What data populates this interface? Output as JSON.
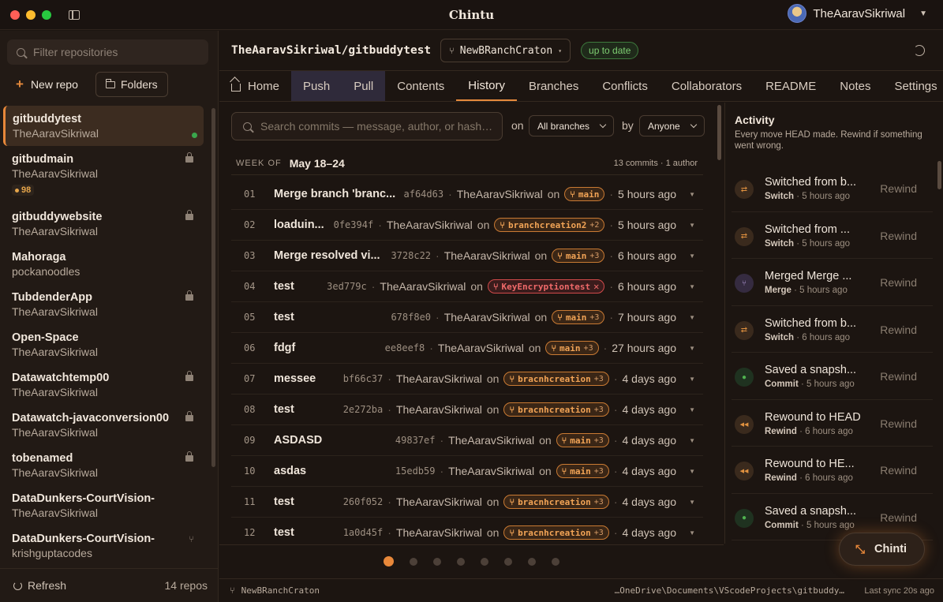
{
  "app": {
    "title": "Chintu",
    "user": "TheAaravSikriwal"
  },
  "colors": {
    "accent": "#e8883a",
    "ok": "#7fcf73",
    "danger": "#f06a6a"
  },
  "sidebar": {
    "filter_placeholder": "Filter repositories",
    "new_repo": "New repo",
    "folders": "Folders",
    "refresh": "Refresh",
    "count": "14 repos",
    "repos": [
      {
        "name": "gitbuddytest",
        "owner": "TheAaravSikriwal",
        "active": true
      },
      {
        "name": "gitbudmain",
        "owner": "TheAaravSikriwal",
        "private": true,
        "badge": "98"
      },
      {
        "name": "gitbuddywebsite",
        "owner": "TheAaravSikriwal",
        "private": true
      },
      {
        "name": "Mahoraga",
        "owner": "pockanoodles"
      },
      {
        "name": "TubdenderApp",
        "owner": "TheAaravSikriwal",
        "private": true
      },
      {
        "name": "Open-Space",
        "owner": "TheAaravSikriwal"
      },
      {
        "name": "Datawatchtemp00",
        "owner": "TheAaravSikriwal",
        "private": true
      },
      {
        "name": "Datawatch-javaconversion00",
        "owner": "TheAaravSikriwal",
        "private": true
      },
      {
        "name": "tobenamed",
        "owner": "TheAaravSikriwal",
        "private": true
      },
      {
        "name": "DataDunkers-CourtVision-",
        "owner": "TheAaravSikriwal"
      },
      {
        "name": "DataDunkers-CourtVision-",
        "owner": "krishguptacodes",
        "fork": true
      }
    ]
  },
  "header": {
    "repo_path": "TheAaravSikriwal/gitbuddytest",
    "branch": "NewBRanchCraton",
    "status": "up to date"
  },
  "tabs": [
    "Home",
    "Push",
    "Pull",
    "Contents",
    "History",
    "Branches",
    "Conflicts",
    "Collaborators",
    "README",
    "Notes",
    "Settings"
  ],
  "history": {
    "search_placeholder": "Search commits — message, author, or hash…",
    "on_label": "on",
    "branch_filter": "All branches",
    "by_label": "by",
    "author_filter": "Anyone",
    "week_label": "WEEK OF",
    "week_range": "May 18–24",
    "week_stats": "13 commits · 1 author",
    "commits": [
      {
        "n": "01",
        "msg": "Merge branch 'branc...",
        "hash": "af64d63",
        "author": "TheAaravSikriwal",
        "on": "on",
        "branch": "main",
        "extra": "",
        "ago": "5 hours ago"
      },
      {
        "n": "02",
        "msg": "loaduin...",
        "hash": "0fe394f",
        "author": "TheAaravSikriwal",
        "on": "on",
        "branch": "branchcreation2",
        "extra": "+2",
        "ago": "5 hours ago"
      },
      {
        "n": "03",
        "msg": "Merge resolved vi...",
        "hash": "3728c22",
        "author": "TheAaravSikriwal",
        "on": "on",
        "branch": "main",
        "extra": "+3",
        "ago": "6 hours ago"
      },
      {
        "n": "04",
        "msg": "test",
        "hash": "3ed779c",
        "author": "TheAaravSikriwal",
        "on": "on",
        "branch": "KeyEncryptiontest",
        "extra": "✕",
        "ago": "6 hours ago",
        "red": true
      },
      {
        "n": "05",
        "msg": "test",
        "hash": "678f8e0",
        "author": "TheAaravSikriwal",
        "on": "on",
        "branch": "main",
        "extra": "+3",
        "ago": "7 hours ago"
      },
      {
        "n": "06",
        "msg": "fdgf",
        "hash": "ee8eef8",
        "author": "TheAaravSikriwal",
        "on": "on",
        "branch": "main",
        "extra": "+3",
        "ago": "27 hours ago"
      },
      {
        "n": "07",
        "msg": "messee",
        "hash": "bf66c37",
        "author": "TheAaravSikriwal",
        "on": "on",
        "branch": "bracnhcreation",
        "extra": "+3",
        "ago": "4 days ago"
      },
      {
        "n": "08",
        "msg": "test",
        "hash": "2e272ba",
        "author": "TheAaravSikriwal",
        "on": "on",
        "branch": "bracnhcreation",
        "extra": "+3",
        "ago": "4 days ago"
      },
      {
        "n": "09",
        "msg": "ASDASD",
        "hash": "49837ef",
        "author": "TheAaravSikriwal",
        "on": "on",
        "branch": "main",
        "extra": "+3",
        "ago": "4 days ago"
      },
      {
        "n": "10",
        "msg": "asdas",
        "hash": "15edb59",
        "author": "TheAaravSikriwal",
        "on": "on",
        "branch": "main",
        "extra": "+3",
        "ago": "4 days ago"
      },
      {
        "n": "11",
        "msg": "test",
        "hash": "260f052",
        "author": "TheAaravSikriwal",
        "on": "on",
        "branch": "bracnhcreation",
        "extra": "+3",
        "ago": "4 days ago"
      },
      {
        "n": "12",
        "msg": "test",
        "hash": "1a0d45f",
        "author": "TheAaravSikriwal",
        "on": "on",
        "branch": "bracnhcreation",
        "extra": "+3",
        "ago": "4 days ago"
      }
    ]
  },
  "activity": {
    "title": "Activity",
    "subtitle": "Every move HEAD made. Rewind if something went wrong.",
    "rewind_label": "Rewind",
    "items": [
      {
        "title": "Switched from b...",
        "kind": "Switch",
        "ago": "5 hours ago",
        "icon": "switch"
      },
      {
        "title": "Switched from ...",
        "kind": "Switch",
        "ago": "5 hours ago",
        "icon": "switch"
      },
      {
        "title": "Merged Merge ...",
        "kind": "Merge",
        "ago": "5 hours ago",
        "icon": "merge"
      },
      {
        "title": "Switched from b...",
        "kind": "Switch",
        "ago": "6 hours ago",
        "icon": "switch"
      },
      {
        "title": "Saved a snapsh...",
        "kind": "Commit",
        "ago": "5 hours ago",
        "icon": "commit"
      },
      {
        "title": "Rewound to HEAD",
        "kind": "Rewind",
        "ago": "6 hours ago",
        "icon": "rewind"
      },
      {
        "title": "Rewound to HE...",
        "kind": "Rewind",
        "ago": "6 hours ago",
        "icon": "rewind"
      },
      {
        "title": "Saved a snapsh...",
        "kind": "Commit",
        "ago": "5 hours ago",
        "icon": "commit"
      }
    ]
  },
  "pager": {
    "pages": 8,
    "current": 1
  },
  "assistant": {
    "label": "Chinti"
  },
  "status": {
    "branch": "NewBRanchCraton",
    "path": "…OneDrive\\Documents\\VScodeProjects\\gitbuddy…",
    "sync": "Last sync 20s ago"
  }
}
